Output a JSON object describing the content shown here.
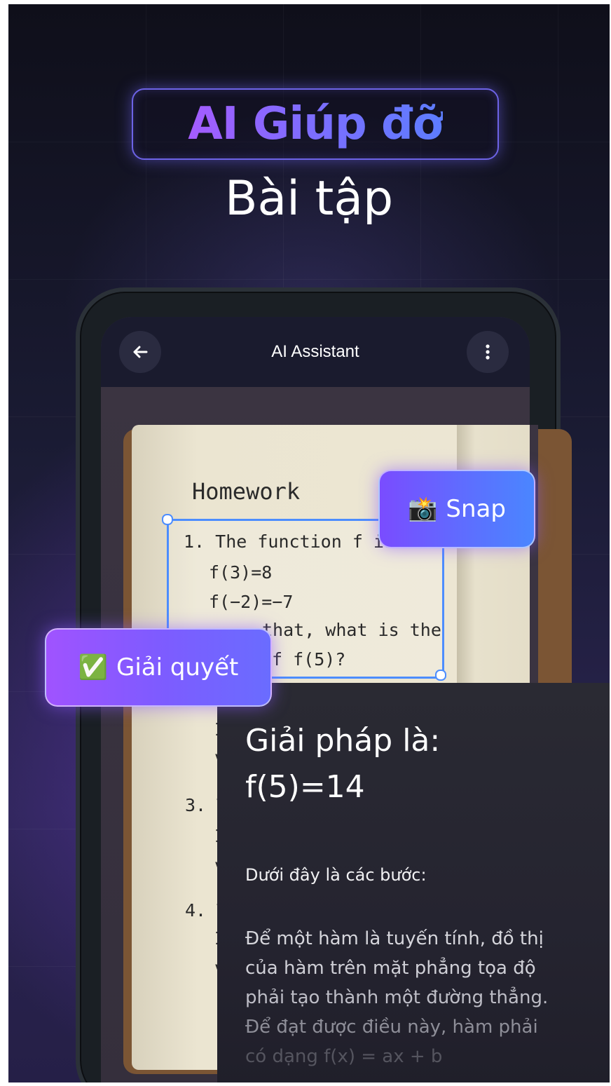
{
  "headline": {
    "line1": "AI Giúp đỡ",
    "line2": "Bài tập"
  },
  "app": {
    "title": "AI Assistant",
    "back_icon": "arrow-left-icon",
    "menu_icon": "more-vertical-icon"
  },
  "notebook": {
    "heading": "Homework",
    "q1_line1": "1. The function f is l",
    "q1_line2": "f(3)=8",
    "q1_line3": "f(−2)=−7",
    "q1_line4": "that, what is the",
    "q1_line5": "f f(5)?",
    "q3_prefix": "3. T",
    "q4_prefix": "4. T",
    "margin_i1": "I",
    "margin_v1": "v",
    "margin_i2": "I",
    "margin_v2": "v",
    "margin_i3": "I",
    "margin_v3": "v"
  },
  "chips": {
    "snap_emoji": "📸",
    "snap_label": "Snap",
    "solve_emoji": "✅",
    "solve_label": "Giải quyết"
  },
  "result": {
    "title_line1": "Giải pháp là:",
    "title_line2": "f(5)=14",
    "subtitle": "Dưới đây là các bước:",
    "body": [
      "Để một hàm là tuyến tính, đồ thị",
      "của hàm trên mặt phẳng tọa độ",
      "phải tạo thành một đường thẳng.",
      "Để đạt được điều này, hàm phải",
      "có dạng f(x) = ax + b"
    ]
  },
  "colors": {
    "accent_purple": "#a45cff",
    "accent_blue": "#4c8dff"
  }
}
